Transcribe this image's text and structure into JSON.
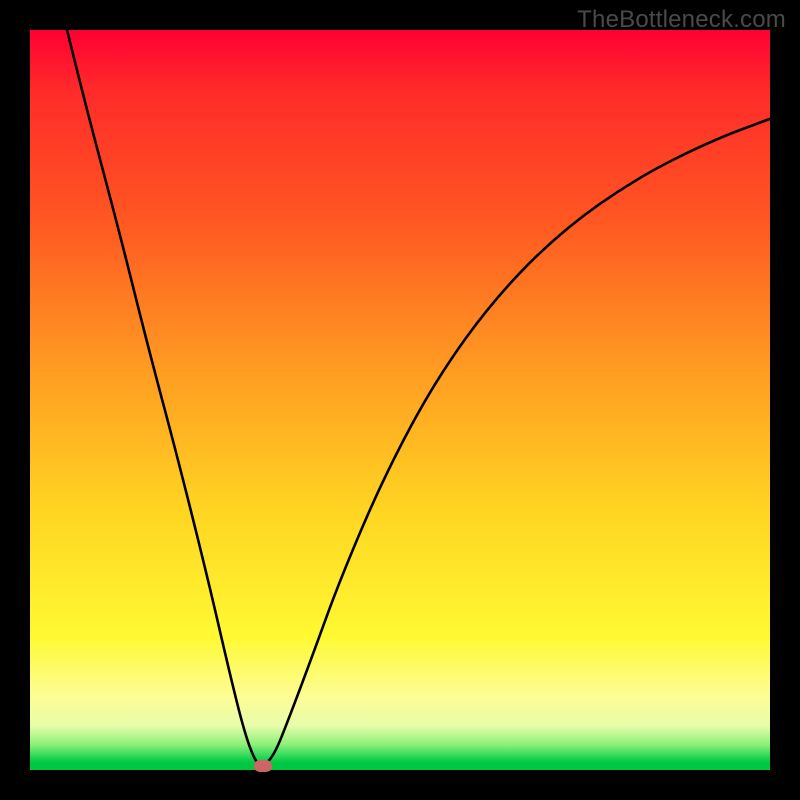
{
  "watermark": "TheBottleneck.com",
  "chart_data": {
    "type": "line",
    "title": "",
    "xlabel": "",
    "ylabel": "",
    "xlim": [
      0,
      100
    ],
    "ylim": [
      0,
      100
    ],
    "grid": false,
    "legend": false,
    "background_gradient": {
      "top_color": "#ff0033",
      "bottom_color": "#00c742",
      "description": "vertical rainbow gradient red->orange->yellow->green"
    },
    "series": [
      {
        "name": "bottleneck-curve",
        "color": "#000000",
        "x": [
          5,
          8,
          12,
          16,
          20,
          24,
          27,
          29,
          30.5,
          31.5,
          33,
          35,
          38,
          42,
          48,
          55,
          63,
          72,
          82,
          92,
          100
        ],
        "y": [
          100,
          88,
          73,
          57,
          42,
          26,
          13,
          5,
          1,
          0.5,
          2,
          7,
          15,
          26,
          40,
          53,
          64,
          73,
          80,
          85,
          88
        ]
      }
    ],
    "marker": {
      "name": "optimal-point",
      "x": 31.5,
      "y": 0.5,
      "color": "#cc6666"
    }
  }
}
